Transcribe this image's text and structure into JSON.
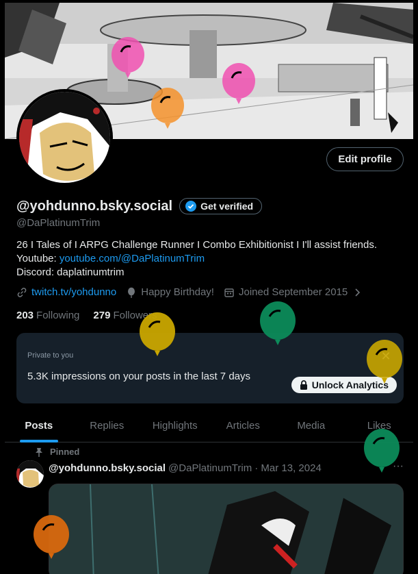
{
  "profile": {
    "display_name": "@yohdunno.bsky.social",
    "handle": "@DaPlatinumTrim",
    "edit_profile_label": "Edit profile",
    "get_verified_label": "Get verified",
    "bio_line1": "26 I Tales of I ARPG Challenge Runner I Combo Exhibitionist I I'll assist friends.",
    "bio_youtube_prefix": "Youtube: ",
    "bio_youtube_link": "youtube.com/@DaPlatinumTrim",
    "bio_discord": "Discord: daplatinumtrim",
    "website": "twitch.tv/yohdunno",
    "birthday": "Happy Birthday!",
    "joined": "Joined September 2015",
    "following_count": "203",
    "following_label": "Following",
    "followers_count": "279",
    "followers_label": "Followers"
  },
  "private_card": {
    "label": "Private to you",
    "text": "5.3K impressions on your posts in the last 7 days",
    "unlock_label": "Unlock Analytics"
  },
  "tabs": [
    {
      "label": "Posts",
      "active": true
    },
    {
      "label": "Replies"
    },
    {
      "label": "Highlights"
    },
    {
      "label": "Articles"
    },
    {
      "label": "Media"
    },
    {
      "label": "Likes"
    }
  ],
  "post": {
    "pinned_label": "Pinned",
    "name": "@yohdunno.bsky.social",
    "handle": "@DaPlatinumTrim",
    "date": "· Mar 13, 2024",
    "more": "···"
  },
  "colors": {
    "accent": "#1d9bf0",
    "balloon_pink": "#f050b0",
    "balloon_orange": "#f5922b",
    "balloon_yellow": "#c9a600",
    "balloon_green": "#0c8b5a"
  },
  "icons": [
    "verified-icon",
    "link-icon",
    "balloon-icon",
    "calendar-icon",
    "chevron-right-icon",
    "close-icon",
    "lock-icon",
    "pin-icon",
    "more-icon"
  ]
}
